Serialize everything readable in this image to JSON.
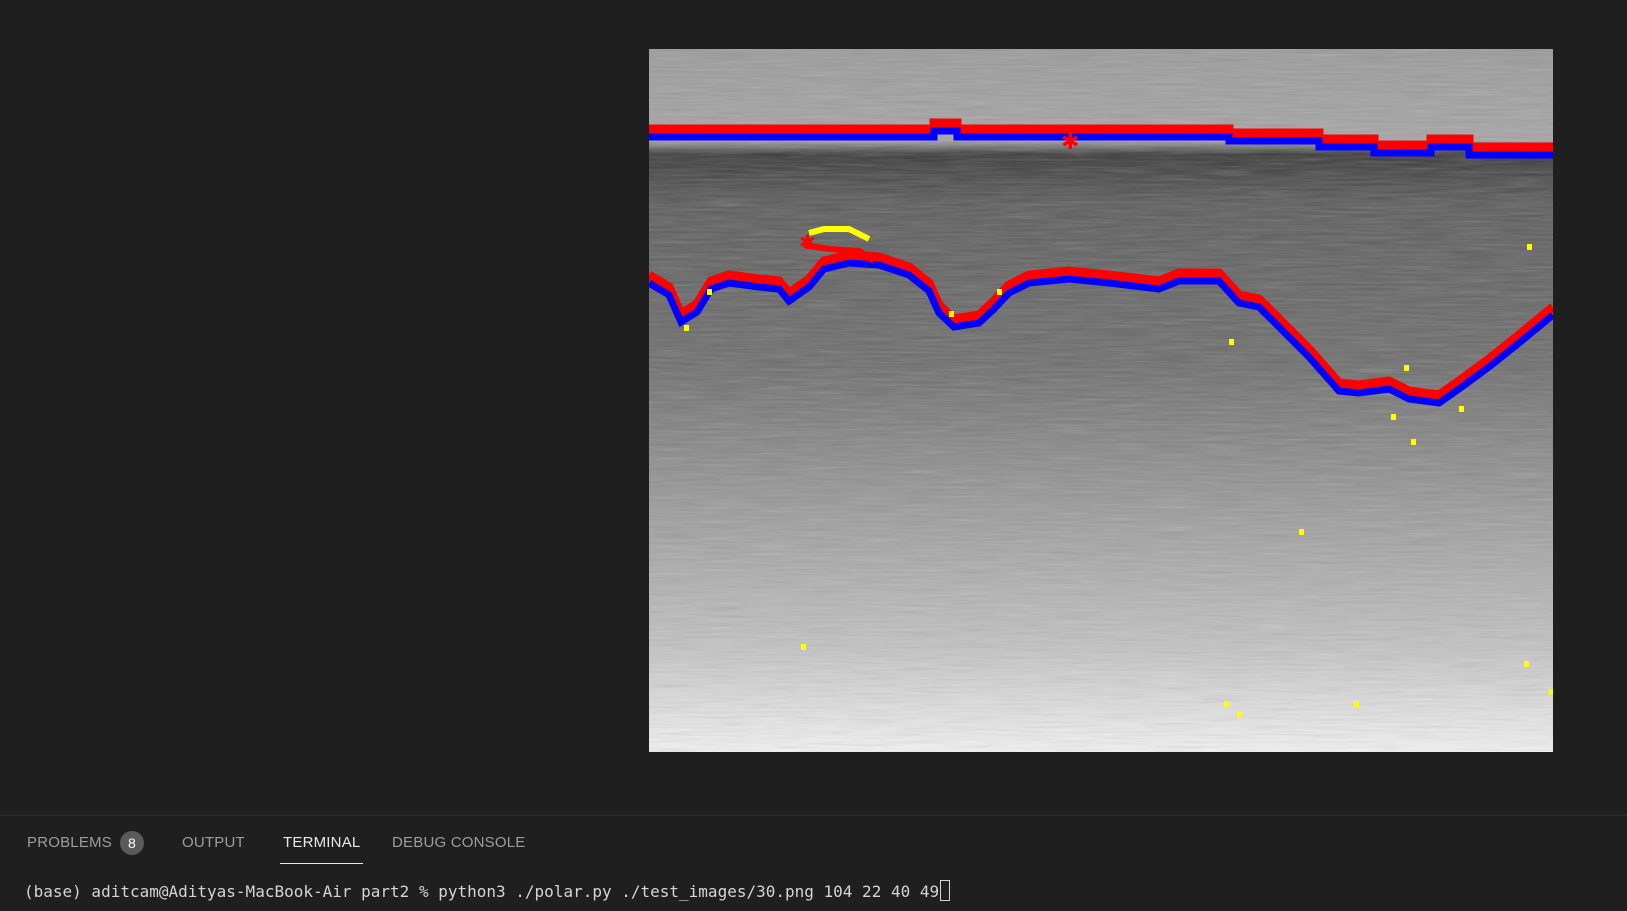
{
  "image_viewer": {
    "description_icon": "image-canvas"
  },
  "panel": {
    "tabs": [
      {
        "label": "PROBLEMS",
        "badge": "8"
      },
      {
        "label": "OUTPUT"
      },
      {
        "label": "TERMINAL",
        "active": true
      },
      {
        "label": "DEBUG CONSOLE"
      }
    ]
  },
  "terminal": {
    "line": "(base) aditcam@Adityas-MacBook-Air part2 % python3 ./polar.py ./test_images/30.png 104 22 40 49"
  },
  "colors": {
    "background": "#1f1f1f",
    "boundary_red": "#ff0000",
    "boundary_blue": "#0000ff",
    "boundary_yellow": "#ffff00"
  }
}
